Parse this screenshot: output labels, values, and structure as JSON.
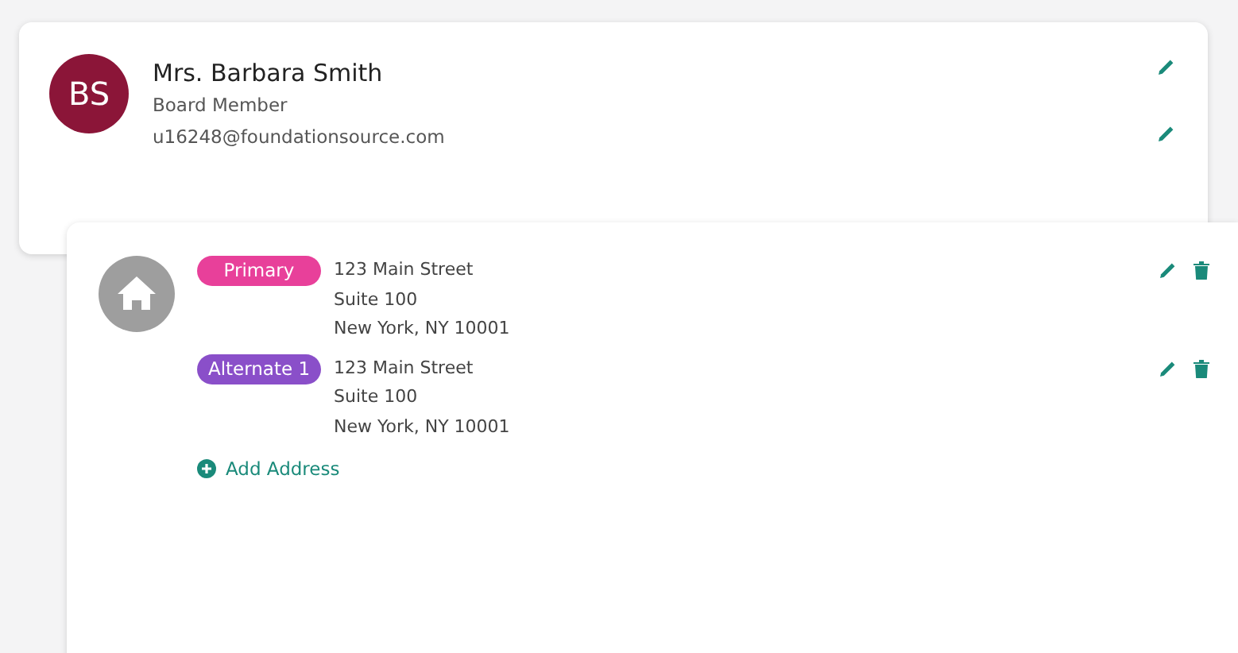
{
  "contact": {
    "initials": "BS",
    "name": "Mrs. Barbara Smith",
    "role": "Board Member",
    "email": "u16248@foundationsource.com"
  },
  "addresses": [
    {
      "label": "Primary",
      "color": "#e8409a",
      "lines": [
        "123 Main Street",
        "Suite 100",
        "New York, NY  10001"
      ]
    },
    {
      "label": "Alternate 1",
      "color": "#8a4fc9",
      "lines": [
        "123 Main Street",
        "Suite 100",
        "New York, NY  10001"
      ]
    }
  ],
  "add_link": "Add Address"
}
